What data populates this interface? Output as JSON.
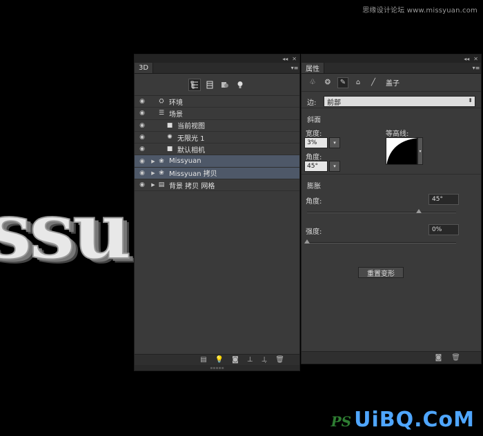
{
  "watermark": {
    "top_text": "思缘设计论坛 www.missyuan.com",
    "bottom_ps": "PS",
    "bottom_site": "UiBQ.CoM"
  },
  "canvas": {
    "text": "ssu"
  },
  "panel_3d": {
    "tab_label": "3D",
    "tree": [
      {
        "label": "环境",
        "icon": "environment-icon",
        "visible": true,
        "selected": false,
        "expandable": false,
        "indent": 0
      },
      {
        "label": "场景",
        "icon": "scene-icon",
        "visible": true,
        "selected": false,
        "expandable": false,
        "indent": 0
      },
      {
        "label": "当前视图",
        "icon": "camera-icon",
        "visible": true,
        "selected": false,
        "expandable": false,
        "indent": 1
      },
      {
        "label": "无限光 1",
        "icon": "light-icon",
        "visible": true,
        "selected": false,
        "expandable": false,
        "indent": 1
      },
      {
        "label": "默认相机",
        "icon": "camera-icon",
        "visible": true,
        "selected": false,
        "expandable": false,
        "indent": 1
      },
      {
        "label": "Missyuan",
        "icon": "mesh-icon",
        "visible": true,
        "selected": true,
        "expandable": true,
        "indent": 0
      },
      {
        "label": "Missyuan 拷贝",
        "icon": "mesh-icon",
        "visible": true,
        "selected": true,
        "expandable": true,
        "indent": 0
      },
      {
        "label": "背景 拷贝 网格",
        "icon": "mesh-layer-icon",
        "visible": true,
        "selected": false,
        "expandable": true,
        "indent": 0
      }
    ]
  },
  "panel_props": {
    "tab_label": "属性",
    "cap_label": "盖子",
    "edge_label": "边:",
    "edge_value": "前部",
    "bevel": {
      "title": "斜面",
      "width_label": "宽度:",
      "width_value": "3%",
      "angle_label": "角度:",
      "angle_value": "45°",
      "contour_label": "等高线:"
    },
    "inflate": {
      "title": "膨胀",
      "angle_label": "角度:",
      "angle_value": "45°",
      "angle_fraction": 0.75,
      "strength_label": "强度:",
      "strength_value": "0%",
      "strength_fraction": 0
    },
    "reset_button": "重置变形"
  }
}
